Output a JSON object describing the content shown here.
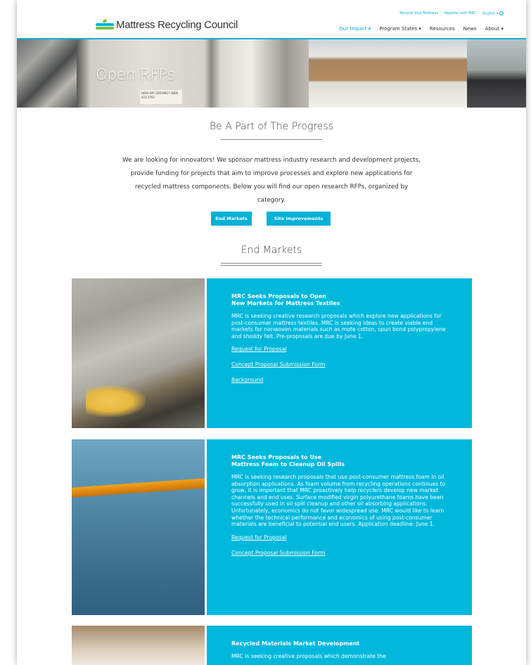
{
  "site": {
    "logo_text": "Mattress Recycling Council"
  },
  "utility_nav": {
    "recycle": "Recycle Your Mattress",
    "register": "Register with MRC",
    "language": "English ▾"
  },
  "main_nav": [
    {
      "label": "Our Impact ▾",
      "active": true
    },
    {
      "label": "Program States ▾",
      "active": false
    },
    {
      "label": "Resources",
      "active": false
    },
    {
      "label": "News",
      "active": false
    },
    {
      "label": "About ▾",
      "active": false
    }
  ],
  "hero": {
    "title": "Open RFPs",
    "sign_text": "HOW AM I DRIVING? (888) 423-1787"
  },
  "intro": {
    "heading": "Be A Part of The Progress",
    "paragraph": "We are looking for innovators! We sponsor mattress industry research and development projects, provide funding for projects that aim to improve processes and explore new applications for recycled mattress components. Below you will find our open research RFPs, organized by category.",
    "buttons": [
      "End Markets",
      "Site Improvements"
    ]
  },
  "end_markets": {
    "heading": "End Markets",
    "cards": [
      {
        "title_line1": "MRC Seeks Proposals to Open",
        "title_line2": "New Markets for Mattress Textiles",
        "body": "MRC is seeking creative research proposals which explore new applications for post-consumer mattress textiles. MRC is seeking ideas to create viable end markets for nonwoven materials such as mote cotton, spun bond polypropylene and shoddy felt. Pre-proposals are due by June 1.",
        "links": [
          "Request for Proposal",
          "Concept Proposal Submission Form",
          "Background"
        ]
      },
      {
        "title_line1": "MRC Seeks Proposals to Use",
        "title_line2": "Mattress Foam to Cleanup Oil Spills",
        "body": "MRC is seeking research proposals that use post-consumer mattress foam in oil absorption applications. As foam volume from recycling operations continues to grow, it is important that MRC proactively help recyclers develop new market channels and end uses. Surface modified virgin polyurethane foams have been successfully used in oil spill cleanup and other oil absorbing applications.  Unfortunately, economics do not favor widespread use. MRC would like to learn whether the technical performance and economics of using post-consumer materials are beneficial to potential end users. Application deadline: June 1.",
        "links": [
          "Request for Proposal",
          "Concept Proposal Submission Form"
        ]
      },
      {
        "title_line1": "Recycled Materials Market Development",
        "title_line2": "",
        "body": "MRC is seeking creative proposals which demonstrate the",
        "links": []
      }
    ]
  },
  "colors": {
    "accent": "#00b2d6",
    "panel": "#00b8dc",
    "text": "#333333"
  }
}
